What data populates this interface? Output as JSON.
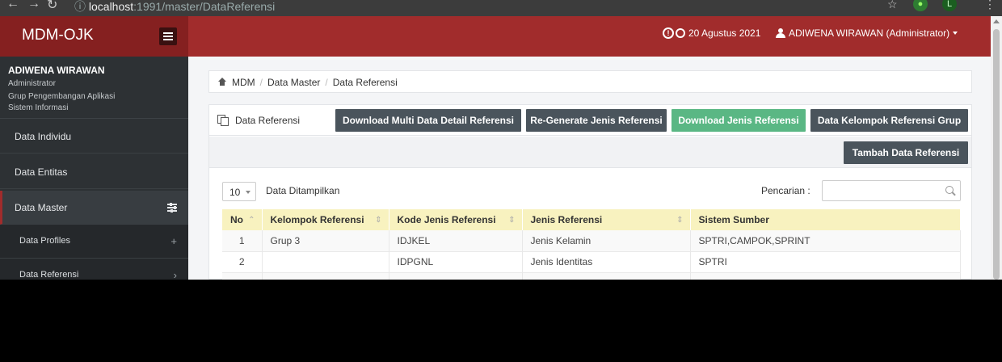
{
  "browser": {
    "url_host": "localhost",
    "url_rest": ":1991/master/DataReferensi",
    "profile_initial": "L"
  },
  "header": {
    "brand": "MDM-OJK",
    "date": "20 Agustus 2021",
    "user": "ADIWENA WIRAWAN (Administrator)"
  },
  "profile": {
    "name": "ADIWENA WIRAWAN",
    "role": "Administrator",
    "group": "Grup Pengembangan Aplikasi",
    "unit": "Sistem Informasi"
  },
  "sidebar": {
    "items": [
      {
        "label": "Data Individu"
      },
      {
        "label": "Data Entitas"
      },
      {
        "label": "Data Master"
      },
      {
        "label": "Data Profiles"
      },
      {
        "label": "Data Referensi"
      }
    ]
  },
  "breadcrumb": [
    "MDM",
    "Data Master",
    "Data Referensi"
  ],
  "panel": {
    "title": "Data Referensi",
    "buttons": {
      "download_multi": "Download Multi Data Detail Referensi",
      "regenerate": "Re-Generate Jenis Referensi",
      "download_jenis": "Download Jenis Referensi",
      "kelompok_grup": "Data Kelompok Referensi Grup",
      "tambah": "Tambah Data Referensi"
    },
    "page_length": "10",
    "page_length_label": "Data Ditampilkan",
    "search_label": "Pencarian :",
    "search_value": ""
  },
  "table": {
    "columns": [
      "No",
      "Kelompok Referensi",
      "Kode Jenis Referensi",
      "Jenis Referensi",
      "Sistem Sumber"
    ],
    "rows": [
      [
        "1",
        "Grup 3",
        "IDJKEL",
        "Jenis Kelamin",
        "SPTRI,CAMPOK,SPRINT"
      ],
      [
        "2",
        "",
        "IDPGNL",
        "Jenis Identitas",
        "SPTRI"
      ]
    ]
  },
  "colors": {
    "header_red": "#a12c2c",
    "sidebar_dark": "#2d3134",
    "button_dark": "#4a545c",
    "button_green": "#5ab784",
    "table_header": "#f8f2bf"
  }
}
